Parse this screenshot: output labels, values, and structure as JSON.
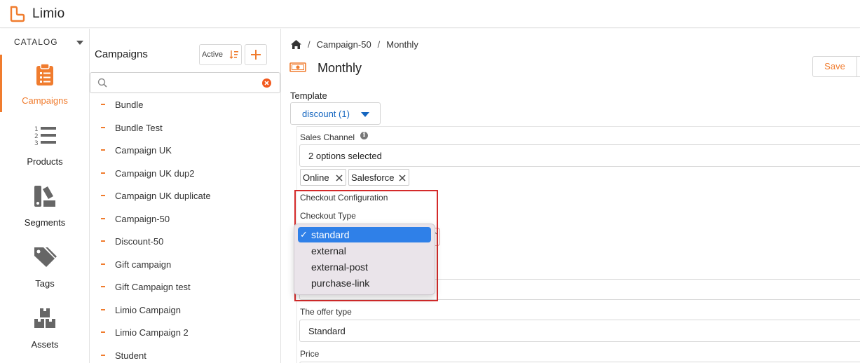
{
  "app": {
    "name": "Limio"
  },
  "colors": {
    "accent": "#f07c2e",
    "link": "#1566c0",
    "highlight": "#d42a2a",
    "selected_option": "#2f80e8"
  },
  "nav": {
    "section_label": "CATALOG",
    "items": [
      {
        "label": "Campaigns",
        "icon": "clipboard-icon",
        "active": true
      },
      {
        "label": "Products",
        "icon": "numbered-list-icon",
        "active": false
      },
      {
        "label": "Segments",
        "icon": "segments-icon",
        "active": false
      },
      {
        "label": "Tags",
        "icon": "tags-icon",
        "active": false
      },
      {
        "label": "Assets",
        "icon": "assets-icon",
        "active": false
      }
    ]
  },
  "campaigns_panel": {
    "title": "Campaigns",
    "filter_label": "Active",
    "search_placeholder": "",
    "items": [
      "Bundle",
      "Bundle Test",
      "Campaign UK",
      "Campaign UK dup2",
      "Campaign UK duplicate",
      "Campaign-50",
      "Discount-50",
      "Gift campaign",
      "Gift Campaign test",
      "Limio Campaign",
      "Limio Campaign 2",
      "Student"
    ]
  },
  "main": {
    "breadcrumb": [
      "Campaign-50",
      "Monthly"
    ],
    "title": "Monthly",
    "save_label": "Save",
    "template": {
      "label": "Template",
      "value": "discount (1)"
    },
    "sales_channel": {
      "label": "Sales Channel",
      "value": "2 options selected",
      "chips": [
        "Online",
        "Salesforce"
      ]
    },
    "checkout": {
      "section_label": "Checkout Configuration",
      "type_label": "Checkout Type",
      "options": [
        {
          "label": "standard",
          "selected": true
        },
        {
          "label": "external",
          "selected": false
        },
        {
          "label": "external-post",
          "selected": false
        },
        {
          "label": "purchase-link",
          "selected": false
        }
      ]
    },
    "offer_type": {
      "label": "The offer type",
      "value": "Standard"
    },
    "price": {
      "label": "Price"
    }
  }
}
